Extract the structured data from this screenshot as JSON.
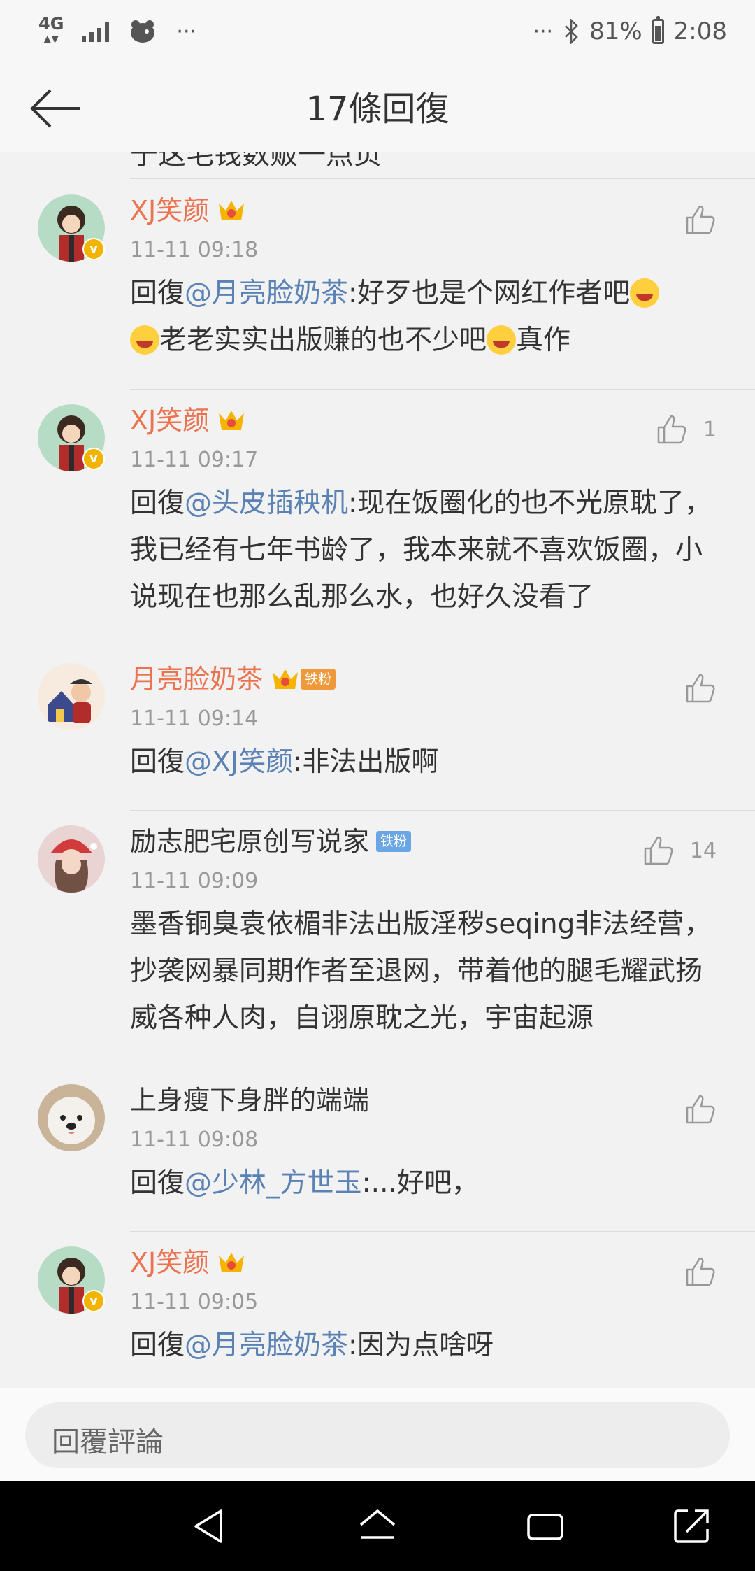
{
  "status_bar": {
    "network": "4G",
    "battery_percent": "81%",
    "time": "2:08"
  },
  "header": {
    "title": "17條回復"
  },
  "partial_text": "于这毛钱数贩一点页",
  "comments": [
    {
      "username": "XJ笑颜",
      "timestamp": "11-11 09:18",
      "reply_prefix": "回復",
      "mention": "@月亮脸奶茶",
      "text": ":好歹也是个网红作者吧",
      "text2": "老老实实出版赚的也不少吧",
      "text3": "真作",
      "likes": ""
    },
    {
      "username": "XJ笑颜",
      "timestamp": "11-11 09:17",
      "reply_prefix": "回復",
      "mention": "@头皮插秧机",
      "text": ":现在饭圈化的也不光原耽了，我已经有七年书龄了，我本来就不喜欢饭圈，小说现在也那么乱那么水，也好久没看了",
      "likes": "1"
    },
    {
      "username": "月亮脸奶茶",
      "fan_badge": "铁粉",
      "timestamp": "11-11 09:14",
      "reply_prefix": "回復",
      "mention": "@XJ笑颜",
      "text": ":非法出版啊",
      "likes": ""
    },
    {
      "username": "励志肥宅原创写说家",
      "fan_badge": "铁粉",
      "timestamp": "11-11 09:09",
      "text": "墨香铜臭袁依楣非法出版淫秽seqing非法经营，抄袭网暴同期作者至退网，带着他的腿毛耀武扬威各种人肉，自诩原耽之光，宇宙起源",
      "likes": "14"
    },
    {
      "username": "上身瘦下身胖的端端",
      "timestamp": "11-11 09:08",
      "reply_prefix": "回復",
      "mention": "@少林_方世玉",
      "text": ":...好吧，",
      "likes": ""
    },
    {
      "username": "XJ笑颜",
      "timestamp": "11-11 09:05",
      "reply_prefix": "回復",
      "mention": "@月亮脸奶茶",
      "text": ":因为点啥呀",
      "likes": ""
    }
  ],
  "reply_bar": {
    "placeholder": "回覆評論"
  },
  "colors": {
    "username_vip": "#eb7350",
    "mention": "#5b82b4",
    "timestamp": "#999999",
    "background": "#f2f2f2"
  }
}
